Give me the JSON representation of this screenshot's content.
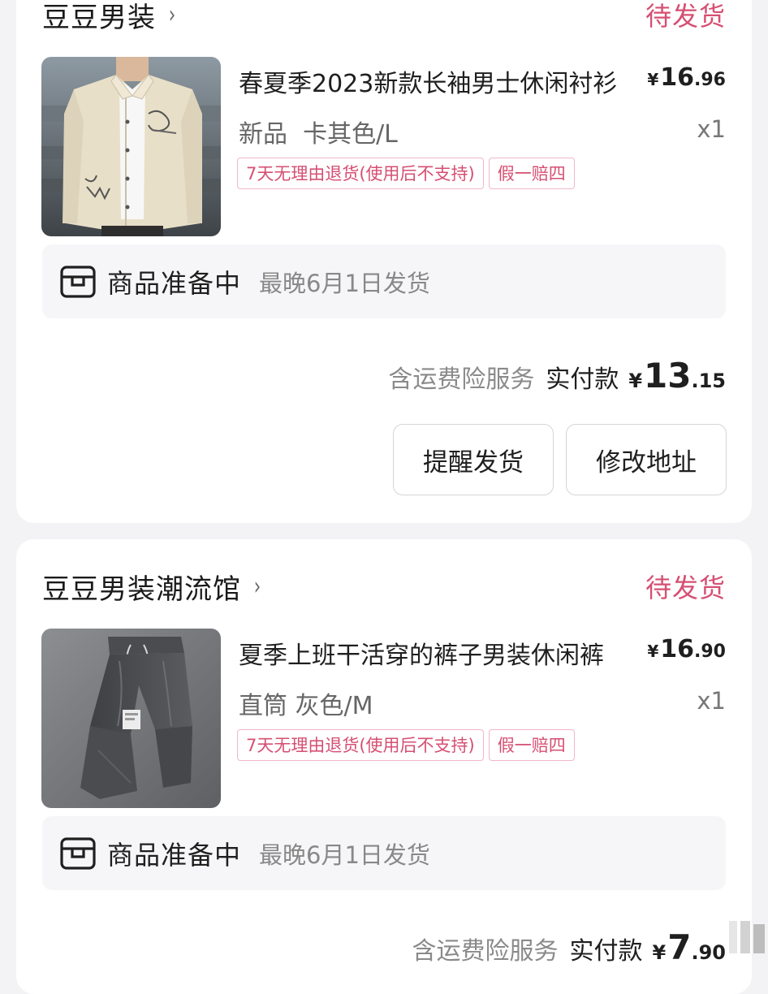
{
  "orders": [
    {
      "shop_name": "豆豆男装",
      "shop_chevron": "›",
      "status": "待发货",
      "product": {
        "image_alt": "beige long-sleeve shirt",
        "title": "春夏季2023新款长袖男士休闲衬衫",
        "price_currency": "¥",
        "price_int": "16",
        "price_dec": ".96",
        "variant": "新品  卡其色/L",
        "quantity": "x1",
        "tags": [
          "7天无理由退货(使用后不支持)",
          "假一赔四"
        ]
      },
      "shipping": {
        "icon": "box-icon",
        "state": "商品准备中",
        "eta": "最晚6月1日发货"
      },
      "payment": {
        "insurance": "含运费险服务",
        "paid_label": "实付款",
        "currency": "¥",
        "amount_int": "13",
        "amount_dec": ".15"
      },
      "buttons": [
        "提醒发货",
        "修改地址"
      ]
    },
    {
      "shop_name": "豆豆男装潮流馆",
      "shop_chevron": "›",
      "status": "待发货",
      "product": {
        "image_alt": "grey casual trousers",
        "title": "夏季上班干活穿的裤子男装休闲裤",
        "price_currency": "¥",
        "price_int": "16",
        "price_dec": ".90",
        "variant": "直筒 灰色/M",
        "quantity": "x1",
        "tags": [
          "7天无理由退货(使用后不支持)",
          "假一赔四"
        ]
      },
      "shipping": {
        "icon": "box-icon",
        "state": "商品准备中",
        "eta": "最晚6月1日发货"
      },
      "payment": {
        "insurance": "含运费险服务",
        "paid_label": "实付款",
        "currency": "¥",
        "amount_int": "7",
        "amount_dec": ".90"
      }
    }
  ],
  "colors": {
    "accent": "#d64f72",
    "tag_border": "#f0b8c8",
    "background": "#f3f3f5",
    "card": "#ffffff"
  }
}
